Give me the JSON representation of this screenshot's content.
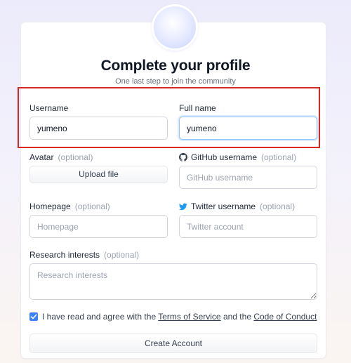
{
  "header": {
    "title": "Complete your profile",
    "subtitle": "One last step to join the community"
  },
  "fields": {
    "username": {
      "label": "Username",
      "value": "yumeno"
    },
    "full_name": {
      "label": "Full name",
      "value": "yumeno"
    },
    "avatar": {
      "label": "Avatar",
      "optional": "(optional)",
      "button": "Upload file"
    },
    "github": {
      "label": "GitHub username",
      "optional": "(optional)",
      "placeholder": "GitHub username",
      "icon": "github-icon"
    },
    "homepage": {
      "label": "Homepage",
      "optional": "(optional)",
      "placeholder": "Homepage"
    },
    "twitter": {
      "label": "Twitter username",
      "optional": "(optional)",
      "placeholder": "Twitter account",
      "icon": "twitter-icon"
    },
    "research": {
      "label": "Research interests",
      "optional": "(optional)",
      "placeholder": "Research interests"
    }
  },
  "agreement": {
    "checked": true,
    "prefix": "I have read and agree with the",
    "terms": "Terms of Service",
    "middle": "and the",
    "conduct": "Code of Conduct"
  },
  "submit": {
    "label": "Create Account"
  },
  "colors": {
    "accent": "#3b82f6",
    "highlight_border": "#dc2626",
    "twitter": "#1d9bf0"
  }
}
